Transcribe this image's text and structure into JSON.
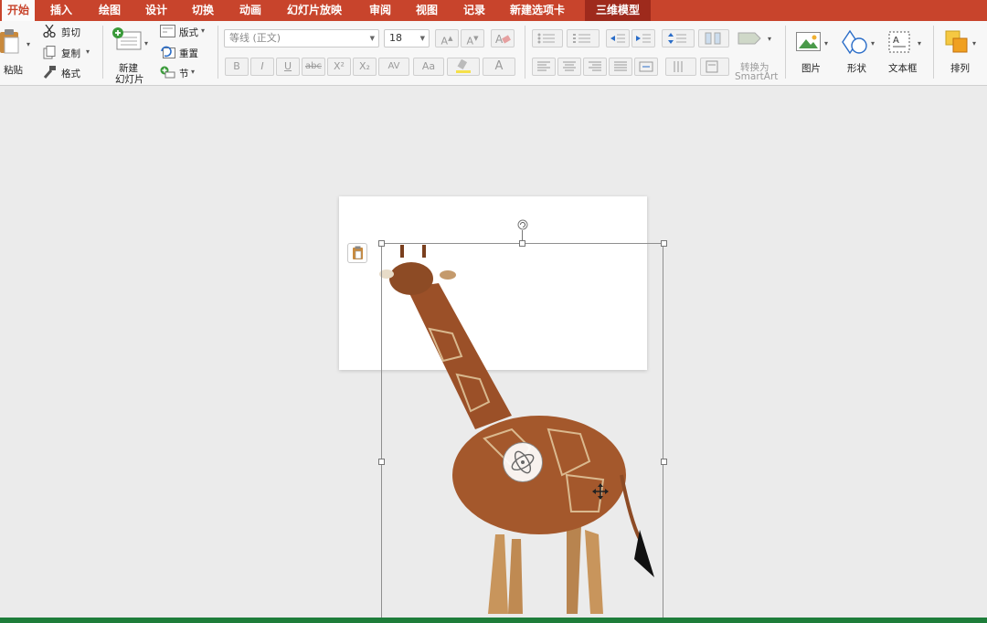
{
  "tabs": [
    {
      "label": "开始",
      "active": true
    },
    {
      "label": "插入"
    },
    {
      "label": "绘图"
    },
    {
      "label": "设计"
    },
    {
      "label": "切换"
    },
    {
      "label": "动画"
    },
    {
      "label": "幻灯片放映"
    },
    {
      "label": "审阅"
    },
    {
      "label": "视图"
    },
    {
      "label": "记录"
    },
    {
      "label": "新建选项卡"
    },
    {
      "label": "三维模型",
      "contextual": true
    }
  ],
  "clipboard": {
    "paste": "粘贴",
    "cut": "剪切",
    "copy": "复制",
    "format": "格式"
  },
  "slides": {
    "new_slide_line1": "新建",
    "new_slide_line2": "幻灯片",
    "layout": "版式",
    "reset": "重置",
    "section": "节"
  },
  "font": {
    "name_placeholder": "等线 (正文)",
    "size": "18",
    "bold": "B",
    "italic": "I",
    "underline": "U",
    "strike": "abc",
    "sup": "X²",
    "sub": "X₂",
    "spacing": "AV",
    "case": "Aa",
    "color": "A"
  },
  "paragraph": {
    "convert_line1": "转换为",
    "convert_line2": "SmartArt"
  },
  "drawing": {
    "picture": "图片",
    "shape": "形状",
    "textbox": "文本框",
    "arrange": "排列"
  },
  "colors": {
    "accent": "#c8442c",
    "context_tab": "#9e2a1c",
    "status": "#1e7d3a"
  }
}
